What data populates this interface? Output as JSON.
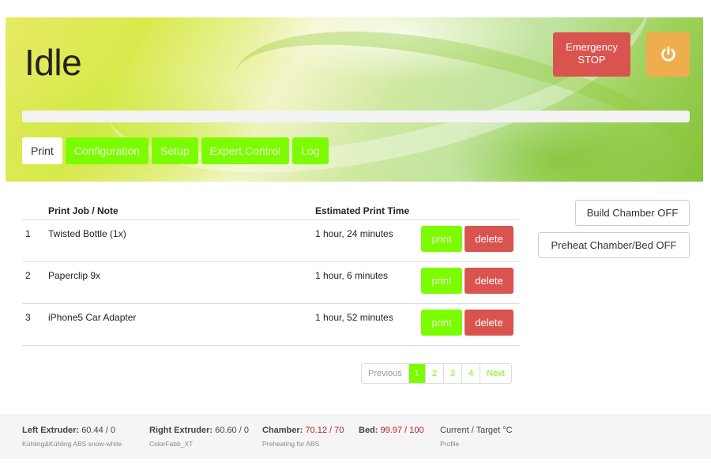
{
  "header": {
    "status_title": "Idle",
    "emergency_line1": "Emergency",
    "emergency_line2": "STOP",
    "progress_fraction": 0
  },
  "tabs": [
    {
      "label": "Print",
      "active": true
    },
    {
      "label": "Configuration",
      "active": false
    },
    {
      "label": "Setup",
      "active": false
    },
    {
      "label": "Expert Control",
      "active": false
    },
    {
      "label": "Log",
      "active": false
    }
  ],
  "jobs": {
    "col_name": "Print Job / Note",
    "col_time": "Estimated Print Time",
    "print_label": "print",
    "delete_label": "delete",
    "rows": [
      {
        "num": "1",
        "name": "Twisted Bottle (1x)",
        "time": "1 hour, 24 minutes"
      },
      {
        "num": "2",
        "name": "Paperclip 9x",
        "time": "1 hour, 6 minutes"
      },
      {
        "num": "3",
        "name": "iPhone5 Car Adapter",
        "time": "1 hour, 52 minutes"
      }
    ]
  },
  "pagination": {
    "previous": "Previous",
    "pages": [
      "1",
      "2",
      "3",
      "4"
    ],
    "current": "1",
    "next": "Next"
  },
  "side": {
    "build_chamber": "Build Chamber OFF",
    "preheat": "Preheat Chamber/Bed OFF"
  },
  "footer": {
    "left_label": "Left Extruder:",
    "left_value": "60.44 / 0",
    "left_sub": "Kühling&Kühling ABS snow-white",
    "right_label": "Right Extruder:",
    "right_value": "60.60 / 0",
    "right_sub": "ColorFabb_XT",
    "chamber_label": "Chamber:",
    "chamber_value": "70.12 / 70",
    "chamber_sub": "Preheating for ABS",
    "bed_label": "Bed:",
    "bed_value": "99.97 / 100",
    "legend": "Current / Target °C",
    "legend_sub": "Profile"
  },
  "colors": {
    "accent_green": "#7cfc00",
    "danger_red": "#d9534f",
    "warning_orange": "#f0ad4e",
    "temp_red": "#b52222"
  },
  "icons": {
    "power": "power-icon"
  }
}
